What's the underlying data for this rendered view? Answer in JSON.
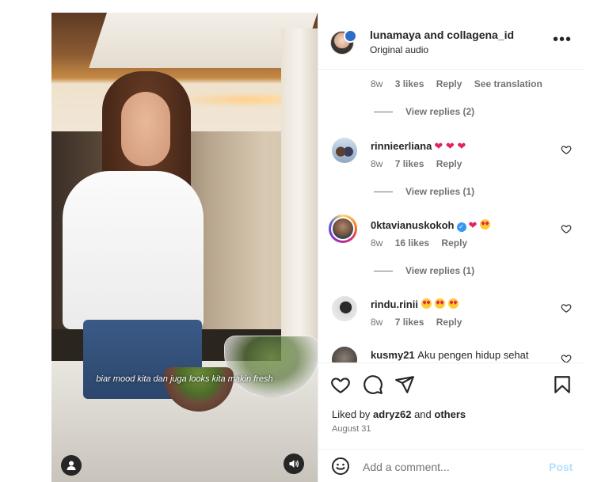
{
  "video": {
    "caption": "biar mood kita dan juga looks kita makin fresh"
  },
  "header": {
    "author": "lunamaya",
    "joiner": " and ",
    "collab": "collagena_id",
    "audio": "Original audio"
  },
  "comments": [
    {
      "username": "",
      "time": "8w",
      "likes": "3 likes",
      "reply": "Reply",
      "translate": "See translation",
      "view_replies": "View replies (2)"
    },
    {
      "username": "rinnieerliana",
      "emoji": "❤ ❤ ❤",
      "time": "8w",
      "likes": "7 likes",
      "reply": "Reply",
      "view_replies": "View replies (1)"
    },
    {
      "username": "0ktavianuskokoh",
      "time": "8w",
      "likes": "16 likes",
      "reply": "Reply",
      "view_replies": "View replies (1)"
    },
    {
      "username": "rindu.rinii",
      "time": "8w",
      "likes": "7 likes",
      "reply": "Reply"
    },
    {
      "username": "kusmy21",
      "text": "Aku pengen hidup sehat"
    }
  ],
  "post": {
    "liked_prefix": "Liked by ",
    "liked_user": "adryz62",
    "liked_and": " and ",
    "liked_others": "others",
    "date": "August 31"
  },
  "add_comment": {
    "placeholder": "Add a comment...",
    "post_label": "Post"
  },
  "colors": {
    "link_disabled": "#b2dffc",
    "heart": "#e0245e",
    "muted": "#737373"
  }
}
